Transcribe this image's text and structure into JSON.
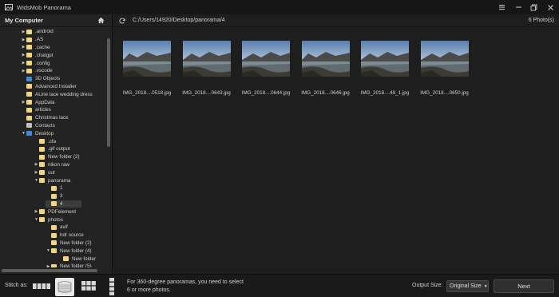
{
  "app": {
    "title": "WidsMob Panorama"
  },
  "sidebar": {
    "title": "My Computer",
    "tree": [
      {
        "label": ".android",
        "level": 1,
        "arrow": "▶",
        "icon": "folder-yellow"
      },
      {
        "label": ".AS",
        "level": 1,
        "arrow": "▶",
        "icon": "folder-yellow"
      },
      {
        "label": ".cache",
        "level": 1,
        "arrow": "▶",
        "icon": "folder-yellow"
      },
      {
        "label": ".chatgpt",
        "level": 1,
        "arrow": "▶",
        "icon": "folder-yellow"
      },
      {
        "label": ".config",
        "level": 1,
        "arrow": "▶",
        "icon": "folder-yellow"
      },
      {
        "label": ".vscode",
        "level": 1,
        "arrow": "▶",
        "icon": "folder-yellow"
      },
      {
        "label": "3D Objects",
        "level": 1,
        "arrow": "",
        "icon": "folder-blue"
      },
      {
        "label": "Advanced Installer",
        "level": 1,
        "arrow": "",
        "icon": "folder-yellow"
      },
      {
        "label": "ALine lace wedding dress",
        "level": 1,
        "arrow": "",
        "icon": "folder-yellow"
      },
      {
        "label": "AppData",
        "level": 1,
        "arrow": "▶",
        "icon": "folder-yellow"
      },
      {
        "label": "articles",
        "level": 1,
        "arrow": "",
        "icon": "folder-yellow"
      },
      {
        "label": "Christmas lace",
        "level": 1,
        "arrow": "",
        "icon": "folder-yellow"
      },
      {
        "label": "Contacts",
        "level": 1,
        "arrow": "",
        "icon": "folder-gray"
      },
      {
        "label": "Desktop",
        "level": 1,
        "arrow": "▼",
        "icon": "folder-blue"
      },
      {
        "label": ".cfa",
        "level": 2,
        "arrow": "",
        "icon": "folder-yellow"
      },
      {
        "label": ".gif output",
        "level": 2,
        "arrow": "",
        "icon": "folder-yellow"
      },
      {
        "label": "New folder (2)",
        "level": 2,
        "arrow": "",
        "icon": "folder-yellow"
      },
      {
        "label": "nikon raw",
        "level": 2,
        "arrow": "▶",
        "icon": "folder-yellow"
      },
      {
        "label": "out",
        "level": 2,
        "arrow": "▶",
        "icon": "folder-yellow"
      },
      {
        "label": "panorama",
        "level": 2,
        "arrow": "▼",
        "icon": "folder-yellow"
      },
      {
        "label": "1",
        "level": 3,
        "arrow": "",
        "icon": "folder-yellow"
      },
      {
        "label": "3",
        "level": 3,
        "arrow": "",
        "icon": "folder-yellow"
      },
      {
        "label": "4",
        "level": 3,
        "arrow": "",
        "icon": "folder-yellow",
        "selected": true
      },
      {
        "label": "PDFelement",
        "level": 2,
        "arrow": "▶",
        "icon": "folder-yellow"
      },
      {
        "label": "photos",
        "level": 2,
        "arrow": "▼",
        "icon": "folder-yellow"
      },
      {
        "label": "avif",
        "level": 3,
        "arrow": "",
        "icon": "folder-yellow"
      },
      {
        "label": "hdr source",
        "level": 3,
        "arrow": "",
        "icon": "folder-yellow"
      },
      {
        "label": "New folder (2)",
        "level": 3,
        "arrow": "",
        "icon": "folder-yellow"
      },
      {
        "label": "New folder (4)",
        "level": 3,
        "arrow": "▼",
        "icon": "folder-yellow"
      },
      {
        "label": "New folder",
        "level": 4,
        "arrow": "",
        "icon": "folder-yellow"
      },
      {
        "label": "New folder (5)",
        "level": 3,
        "arrow": "▶",
        "icon": "folder-yellow"
      }
    ]
  },
  "path": {
    "text": "C:/Users/14920/Desktop/panorama/4",
    "count": "6 Photo(s)"
  },
  "photos": [
    {
      "name": "IMG_2018....0518.jpg"
    },
    {
      "name": "IMG_2018....0643.jpg"
    },
    {
      "name": "IMG_2018....0644.jpg"
    },
    {
      "name": "IMG_2018....0646.jpg"
    },
    {
      "name": "IMG_2018....49_1.jpg"
    },
    {
      "name": "IMG_2018....0650.jpg"
    }
  ],
  "bottom": {
    "stitch_label": "Stitch as:",
    "stitch_options": [
      "horizontal",
      "360-degree",
      "grid",
      "vertical"
    ],
    "selected_option": "360-degree",
    "hint": "For 360-degree panoramas, you need to select 6 or more photos.",
    "output_label": "Output Size:",
    "output_value": "Original Size",
    "next_label": "Next"
  },
  "colors": {
    "folder_yellow": "#f2d680",
    "folder_blue": "#3e8ad8",
    "background": "#1e1e1e",
    "sidebar": "#232323",
    "selection": "#3c3c3c"
  }
}
